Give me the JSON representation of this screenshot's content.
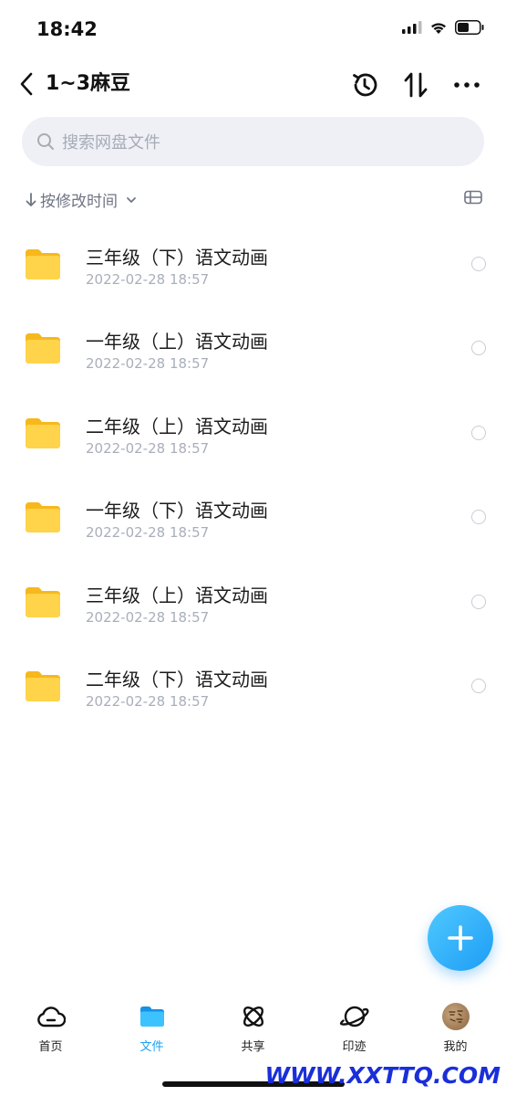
{
  "status": {
    "time": "18:42"
  },
  "nav": {
    "title": "1~3麻豆"
  },
  "search": {
    "placeholder": "搜索网盘文件"
  },
  "sort": {
    "label": "按修改时间"
  },
  "files": [
    {
      "name": "三年级（下）语文动画",
      "date": "2022-02-28 18:57"
    },
    {
      "name": "一年级（上）语文动画",
      "date": "2022-02-28 18:57"
    },
    {
      "name": "二年级（上）语文动画",
      "date": "2022-02-28 18:57"
    },
    {
      "name": "一年级（下）语文动画",
      "date": "2022-02-28 18:57"
    },
    {
      "name": "三年级（上）语文动画",
      "date": "2022-02-28 18:57"
    },
    {
      "name": "二年级（下）语文动画",
      "date": "2022-02-28 18:57"
    }
  ],
  "tabs": [
    {
      "label": "首页",
      "icon": "cloud-icon"
    },
    {
      "label": "文件",
      "icon": "folder-icon"
    },
    {
      "label": "共享",
      "icon": "atom-icon"
    },
    {
      "label": "印迹",
      "icon": "planet-icon"
    },
    {
      "label": "我的",
      "icon": "avatar"
    }
  ],
  "watermark": "WWW.XXTTQ.COM",
  "colors": {
    "accent": "#1da1f2",
    "folder": "#ffd34a"
  }
}
